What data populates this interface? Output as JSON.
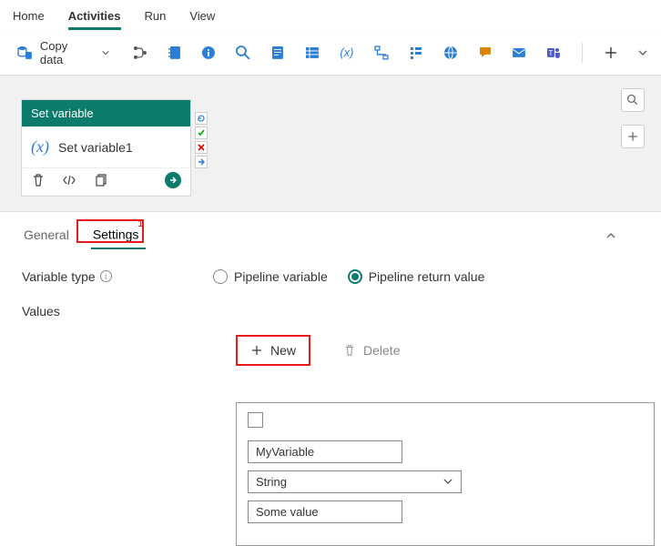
{
  "top_tabs": {
    "home": "Home",
    "activities": "Activities",
    "run": "Run",
    "view": "View",
    "active": "activities"
  },
  "toolbar": {
    "copy_data_label": "Copy data"
  },
  "activity": {
    "header": "Set variable",
    "name": "Set variable1"
  },
  "detail_tabs": {
    "general": "General",
    "settings": "Settings",
    "settings_badge": "1",
    "active": "settings"
  },
  "form": {
    "variable_type_label": "Variable type",
    "values_label": "Values",
    "radio_pipeline_variable": "Pipeline variable",
    "radio_return_value": "Pipeline return value",
    "radio_selected": "return_value",
    "new_label": "New",
    "delete_label": "Delete"
  },
  "values_entry": {
    "name": "MyVariable",
    "type": "String",
    "value": "Some value"
  }
}
